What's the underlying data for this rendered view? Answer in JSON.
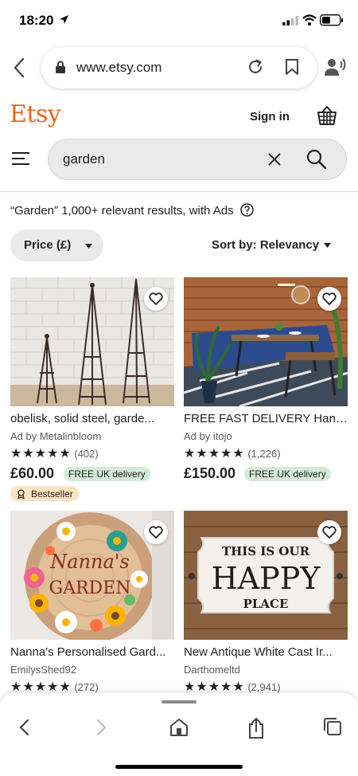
{
  "status": {
    "time": "18:20"
  },
  "browser": {
    "url": "www.etsy.com"
  },
  "header": {
    "logo": "Etsy",
    "sign_in": "Sign in"
  },
  "search": {
    "query": "garden"
  },
  "results": {
    "query_label": "“Garden”",
    "summary": "1,000+ relevant results, with Ads"
  },
  "filters": {
    "price_label": "Price (£)",
    "sort_label": "Sort by: Relevancy"
  },
  "products": [
    {
      "title": "obelisk, solid steel, garde...",
      "seller": "Ad by Metalinbloom",
      "stars": "★★★★★",
      "reviews": "(402)",
      "price": "£60.00",
      "delivery": "FREE UK delivery",
      "badge": "Bestseller"
    },
    {
      "title": "FREE FAST DELIVERY Hand...",
      "seller": "Ad by itojo",
      "stars": "★★★★★",
      "reviews": "(1,226)",
      "price": "£150.00",
      "delivery": "FREE UK delivery"
    },
    {
      "title": "Nanna's Personalised Gard...",
      "seller": "EmilysShed92",
      "stars": "★★★★★",
      "reviews": "(272)",
      "image_text_1": "Nanna's",
      "image_text_2": "GARDEN"
    },
    {
      "title": "New Antique White Cast Ir...",
      "seller": "Darthomeltd",
      "stars": "★★★★★",
      "reviews": "(2,941)",
      "image_text_1": "THIS IS OUR",
      "image_text_2": "HAPPY",
      "image_text_3": "PLACE"
    }
  ],
  "colors": {
    "brand": "#F1641E",
    "delivery_badge": "#d4e9d7",
    "bestseller_badge": "#fde3c1"
  },
  "icons": [
    "location-arrow-icon",
    "signal-icon",
    "wifi-icon",
    "battery-icon",
    "back-icon",
    "lock-icon",
    "reload-icon",
    "bookmark-icon",
    "reader-icon",
    "basket-icon",
    "menu-icon",
    "clear-icon",
    "search-icon",
    "help-icon",
    "chevron-down-icon",
    "heart-icon",
    "forward-icon",
    "home-icon",
    "share-icon",
    "tabs-icon"
  ]
}
